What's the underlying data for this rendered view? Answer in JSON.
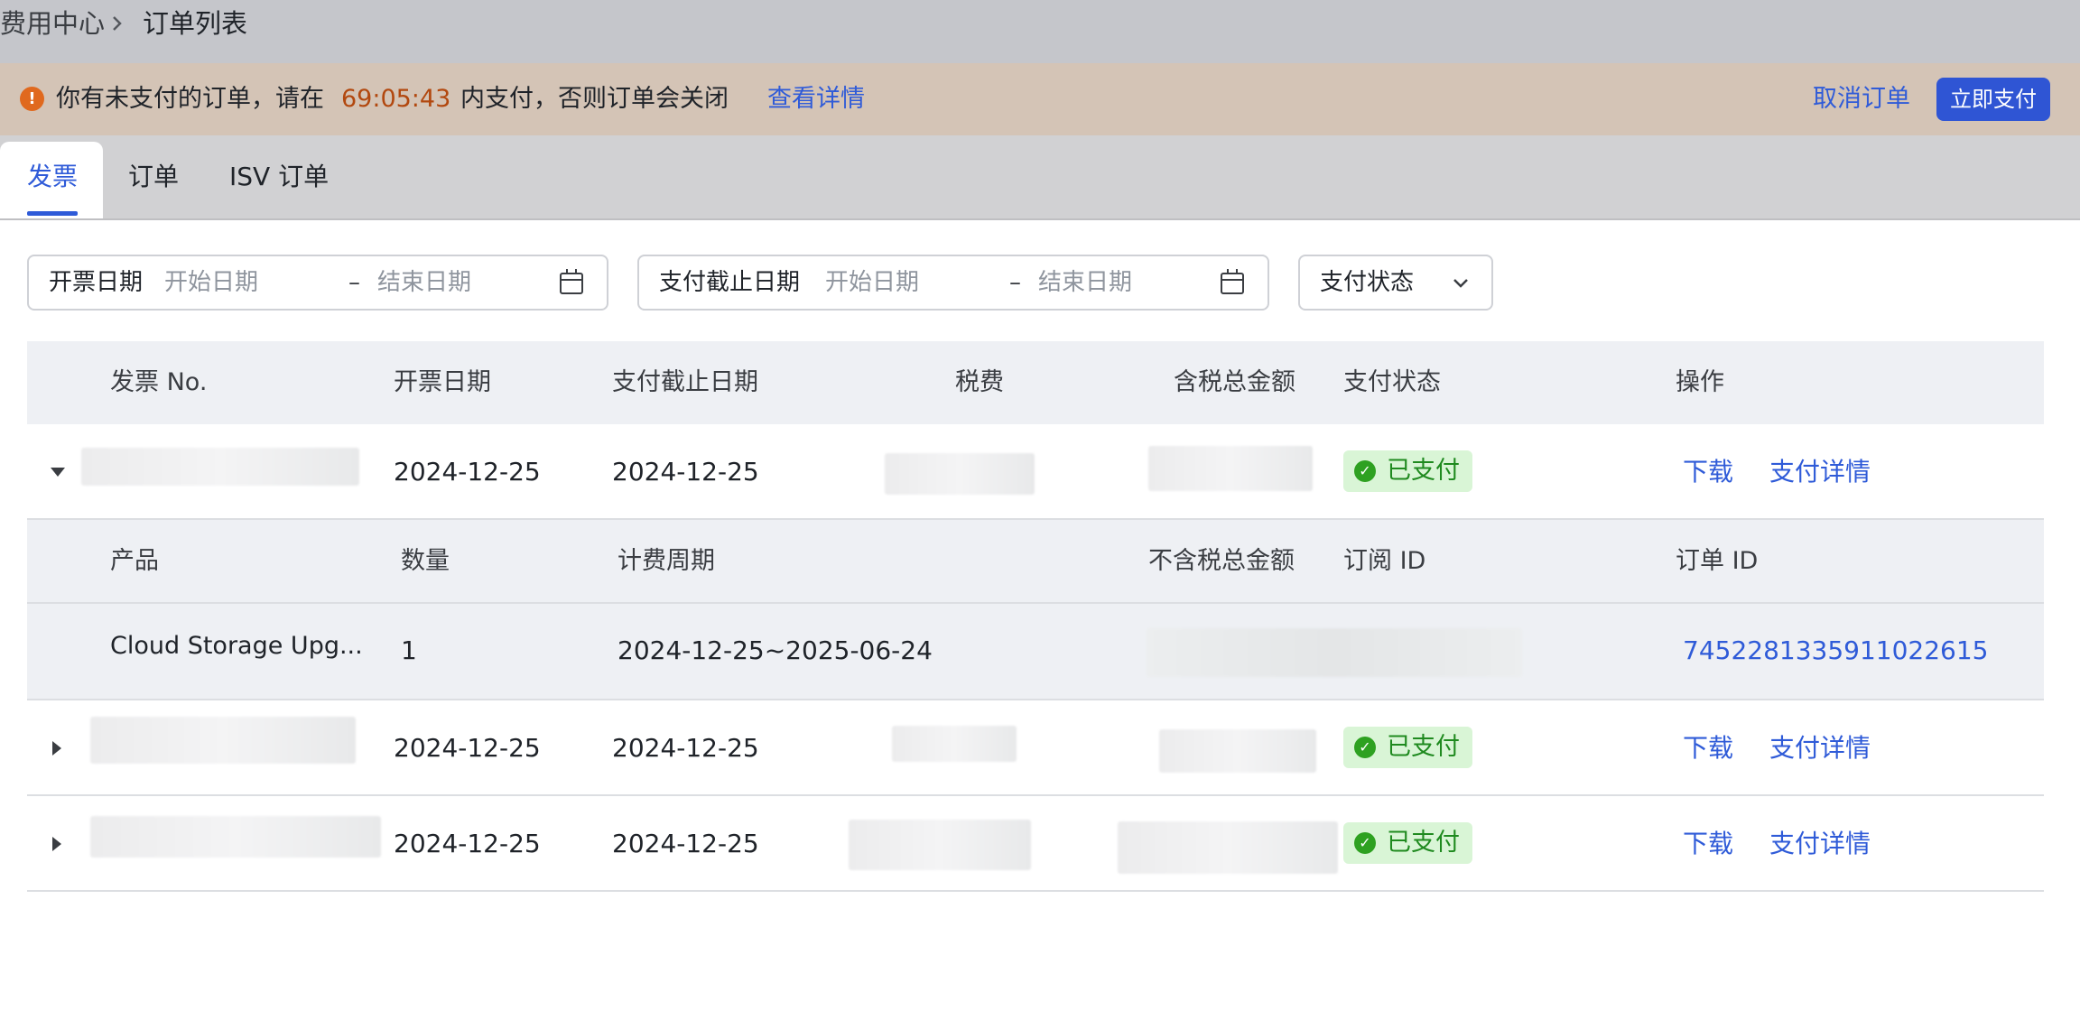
{
  "breadcrumb": {
    "parent": "费用中心",
    "separator_icon": "chevron-right-icon",
    "current": "订单列表"
  },
  "notice": {
    "icon": "exclamation-icon",
    "icon_glyph": "!",
    "text_before": "你有未支付的订单，请在",
    "countdown": "69:05:43",
    "text_after": "内支付，否则订单会关闭",
    "details_link": "查看详情",
    "cancel_label": "取消订单",
    "pay_label": "立即支付"
  },
  "tabs": [
    {
      "label": "发票",
      "active": true
    },
    {
      "label": "订单"
    },
    {
      "label": "ISV 订单"
    }
  ],
  "filters": {
    "invoice_date": {
      "label": "开票日期",
      "start_placeholder": "开始日期",
      "end_placeholder": "结束日期",
      "dash": "–"
    },
    "due_date": {
      "label": "支付截止日期",
      "start_placeholder": "开始日期",
      "end_placeholder": "结束日期",
      "dash": "–"
    },
    "payment_status": {
      "label": "支付状态"
    }
  },
  "table": {
    "headers": [
      "发票 No.",
      "开票日期",
      "支付截止日期",
      "税费",
      "含税总金额",
      "支付状态",
      "操作"
    ],
    "sub_headers": [
      "产品",
      "数量",
      "计费周期",
      "不含税总金额",
      "订阅 ID",
      "订单 ID"
    ],
    "rows": [
      {
        "expanded": true,
        "invoice_date": "2024-12-25",
        "due_date": "2024-12-25",
        "status": "已支付",
        "actions": [
          "下载",
          "支付详情"
        ],
        "detail": {
          "product": "Cloud Storage Upg...",
          "quantity": "1",
          "billing_period": "2024-12-25~2025-06-24",
          "order_id": "7452281335911022615"
        }
      },
      {
        "expanded": false,
        "invoice_date": "2024-12-25",
        "due_date": "2024-12-25",
        "status": "已支付",
        "actions": [
          "下载",
          "支付详情"
        ]
      },
      {
        "expanded": false,
        "invoice_date": "2024-12-25",
        "due_date": "2024-12-25",
        "status": "已支付",
        "actions": [
          "下载",
          "支付详情"
        ]
      }
    ]
  },
  "colors": {
    "accent": "#2f5bd8",
    "pay_button": "#2f55d4",
    "notice_bg": "#d4c4b6",
    "countdown": "#b2480f",
    "paid_badge_bg": "#d9f5d6",
    "paid_badge_text": "#1f8a1f"
  }
}
